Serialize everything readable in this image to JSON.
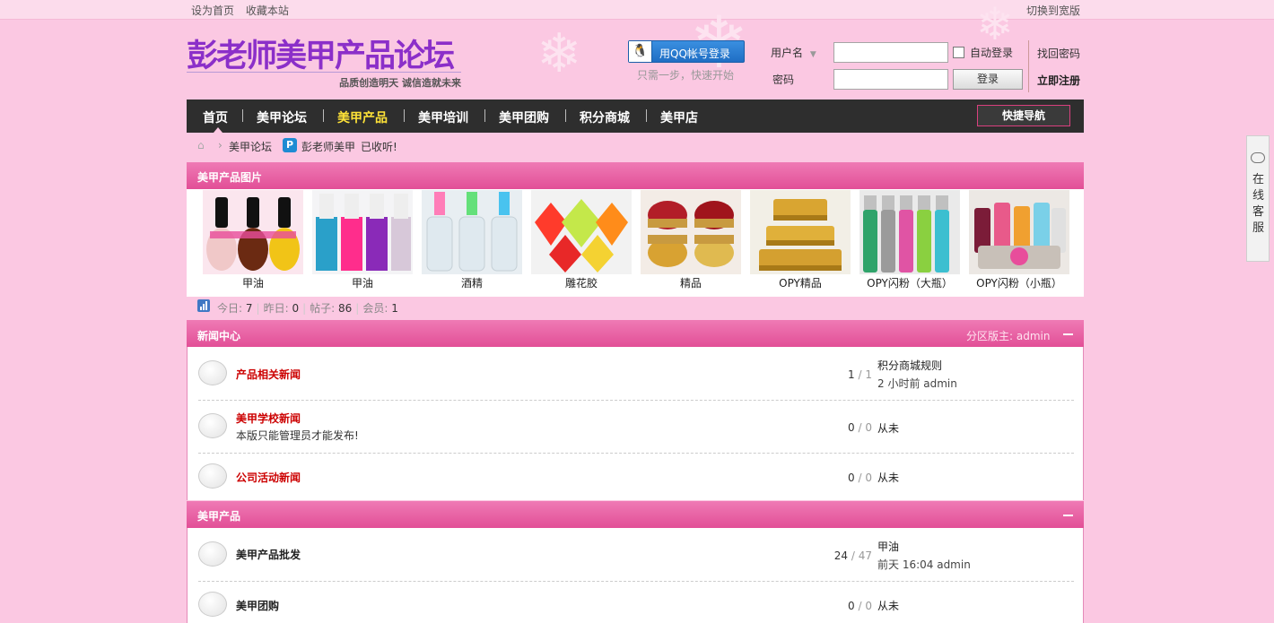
{
  "topbar": {
    "set_home": "设为首页",
    "bookmark": "收藏本站",
    "wide": "切换到宽版"
  },
  "header": {
    "logo": "彭老师美甲产品论坛",
    "slogan": "品质创造明天 诚信造就未来",
    "qq_login": "用QQ帐号登录",
    "qq_tip": "只需一步，快速开始",
    "username_label": "用户名",
    "password_label": "密码",
    "auto_login": "自动登录",
    "find_password": "找回密码",
    "login_button": "登录",
    "register": "立即注册"
  },
  "nav": {
    "items": [
      "首页",
      "美甲论坛",
      "美甲产品",
      "美甲培训",
      "美甲团购",
      "积分商城",
      "美甲店"
    ],
    "active_index": 2,
    "quick_nav": "快捷导航"
  },
  "breadcrumb": {
    "forum": "美甲论坛",
    "user": "彭老师美甲",
    "status": "已收听!"
  },
  "gallery": {
    "title": "美甲产品图片",
    "items": [
      "甲油",
      "甲油",
      "酒精",
      "雕花胶",
      "精品",
      "OPY精品",
      "OPY闪粉（大瓶）",
      "OPY闪粉（小瓶）"
    ]
  },
  "stats": {
    "today_label": "今日:",
    "today": "7",
    "yesterday_label": "昨日:",
    "yesterday": "0",
    "posts_label": "帖子:",
    "posts": "86",
    "members_label": "会员:",
    "members": "1"
  },
  "sections": [
    {
      "title": "新闻中心",
      "moderator": "分区版主: admin",
      "forums": [
        {
          "name": "产品相关新闻",
          "desc": "",
          "threads": "1",
          "posts": "1",
          "last_title": "积分商城规则",
          "last_meta": "2 小时前 admin"
        },
        {
          "name": "美甲学校新闻",
          "desc": "本版只能管理员才能发布!",
          "threads": "0",
          "posts": "0",
          "last_title": "从未",
          "last_meta": ""
        },
        {
          "name": "公司活动新闻",
          "desc": "",
          "threads": "0",
          "posts": "0",
          "last_title": "从未",
          "last_meta": ""
        }
      ]
    },
    {
      "title": "美甲产品",
      "moderator": "",
      "forums": [
        {
          "name": "美甲产品批发",
          "desc": "",
          "threads": "24",
          "posts": "47",
          "last_title": "甲油",
          "last_meta": "前天 16:04 admin"
        },
        {
          "name": "美甲团购",
          "desc": "",
          "threads": "0",
          "posts": "0",
          "last_title": "从未",
          "last_meta": ""
        }
      ]
    }
  ],
  "side_service": "在线客服",
  "colors": {
    "accent": "#e24f97",
    "nav_bg": "#2e2e2e",
    "active_nav": "#ffe338",
    "page_bg": "#fbc8e2"
  }
}
